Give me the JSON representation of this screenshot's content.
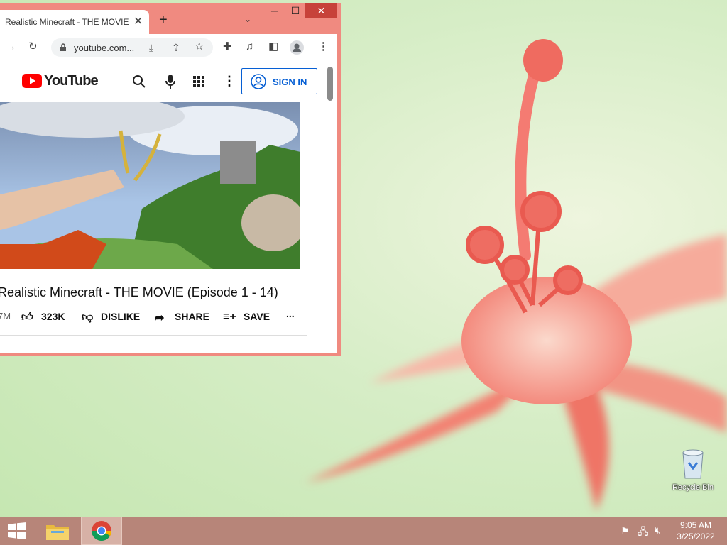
{
  "browser": {
    "tab_title": "Realistic Minecraft - THE MOVIE",
    "tab_close": "✕",
    "new_tab": "+",
    "tab_search": "⌄",
    "minimize": "─",
    "maximize": "☐",
    "close": "✕",
    "url": "youtube.com..."
  },
  "youtube": {
    "logo_text": "YouTube",
    "sign_in": "SIGN IN",
    "video_title": "Realistic Minecraft - THE MOVIE (Episode 1 - 14)",
    "views_fragment": "7M",
    "likes": "323K",
    "dislike": "DISLIKE",
    "share": "SHARE",
    "save": "SAVE",
    "more": "..."
  },
  "desktop": {
    "recycle_bin": "Recycle Bin"
  },
  "taskbar": {
    "time": "9:05 AM",
    "date": "3/25/2022"
  },
  "colors": {
    "window_frame": "#f08a80",
    "youtube_red": "#ff0000",
    "signin_blue": "#065fd4",
    "taskbar": "#b78579"
  }
}
